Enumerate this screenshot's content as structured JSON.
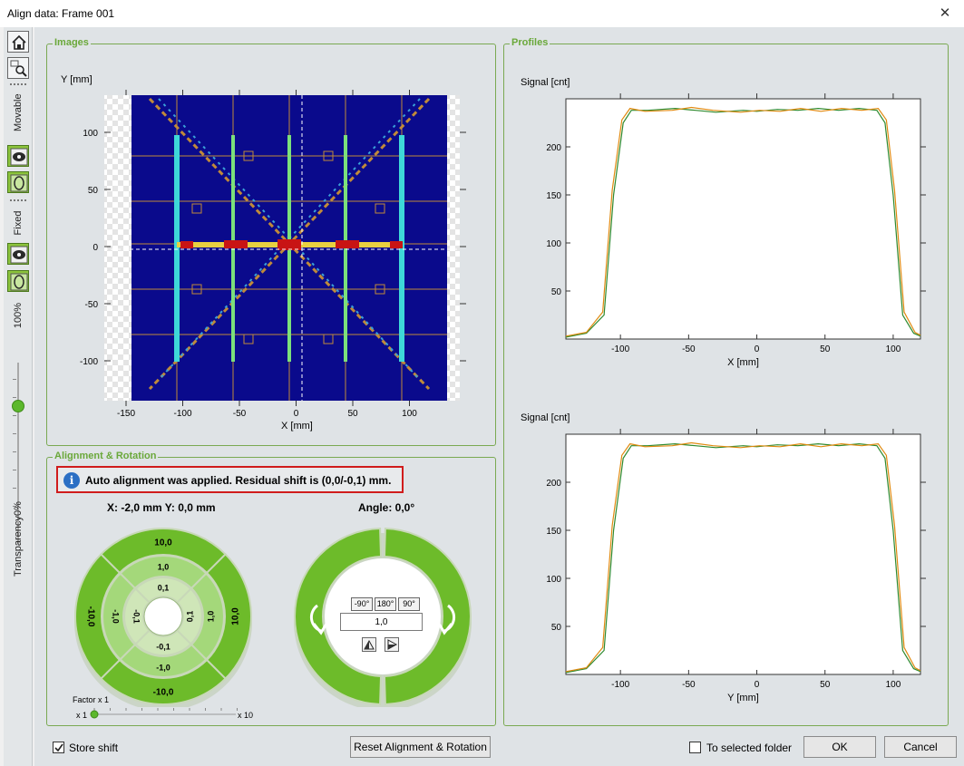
{
  "window": {
    "title": "Align data: Frame 001",
    "close_glyph": "✕"
  },
  "sidebar": {
    "home_icon": "home-icon",
    "search_icon": "search-image-icon",
    "movable_label": "Movable",
    "fixed_label": "Fixed",
    "eye_icon": "eye-icon",
    "outline_icon": "outline-icon",
    "top_percent": "100%",
    "bottom_percent": "0%",
    "transparency_label": "Transparency",
    "transparency_value": 0.76
  },
  "images": {
    "legend": "Images",
    "ylabel": "Y [mm]",
    "xlabel": "X [mm]",
    "xticks": [
      "-150",
      "-100",
      "-50",
      "0",
      "50",
      "100"
    ],
    "yticks": [
      "100",
      "50",
      "0",
      "-50",
      "-100"
    ]
  },
  "profiles": {
    "legend": "Profiles",
    "top": {
      "ylabel": "Signal [cnt]",
      "xlabel": "X [mm]",
      "xticks": [
        "-100",
        "-50",
        "0",
        "50",
        "100"
      ],
      "yticks": [
        "200",
        "150",
        "100",
        "50"
      ]
    },
    "bottom": {
      "ylabel": "Signal [cnt]",
      "xlabel": "Y [mm]",
      "xticks": [
        "-100",
        "-50",
        "0",
        "50",
        "100"
      ],
      "yticks": [
        "200",
        "150",
        "100",
        "50"
      ]
    },
    "colors": {
      "series_a": "#2f8a2f",
      "series_b": "#e08a10"
    }
  },
  "alignment": {
    "legend": "Alignment & Rotation",
    "notice_icon": "info-icon",
    "notice": "Auto alignment was applied. Residual shift is (0,0/-0,1) mm.",
    "position": "X: -2,0 mm Y: 0,0 mm",
    "angle": "Angle: 0,0°",
    "shift_labels": {
      "outer_top": "10,0",
      "outer_bottom": "-10,0",
      "outer_left": "-10,0",
      "outer_right": "10,0",
      "mid_top": "1,0",
      "mid_bottom": "-1,0",
      "mid_left": "-1,0",
      "mid_right": "1,0",
      "inner_top": "0,1",
      "inner_bottom": "-0,1",
      "inner_left": "-0,1",
      "inner_right": "0,1"
    },
    "factor_label": "Factor x 1",
    "factor_min": "x 1",
    "factor_max": "x 10",
    "factor_value": 1,
    "rotate_buttons": [
      "-90°",
      "180°",
      "90°"
    ],
    "angle_step_value": "1,0",
    "rotate_ccw_icon": "rotate-ccw-arrow-icon",
    "rotate_cw_icon": "rotate-cw-arrow-icon",
    "flip_left_icon": "flip-left-icon",
    "flip_right_icon": "flip-right-icon"
  },
  "footer": {
    "store_shift_label": "Store shift",
    "store_shift_checked": true,
    "reset_label": "Reset Alignment & Rotation",
    "selected_folder_label": "To selected folder",
    "selected_folder_checked": false,
    "ok_label": "OK",
    "cancel_label": "Cancel"
  }
}
